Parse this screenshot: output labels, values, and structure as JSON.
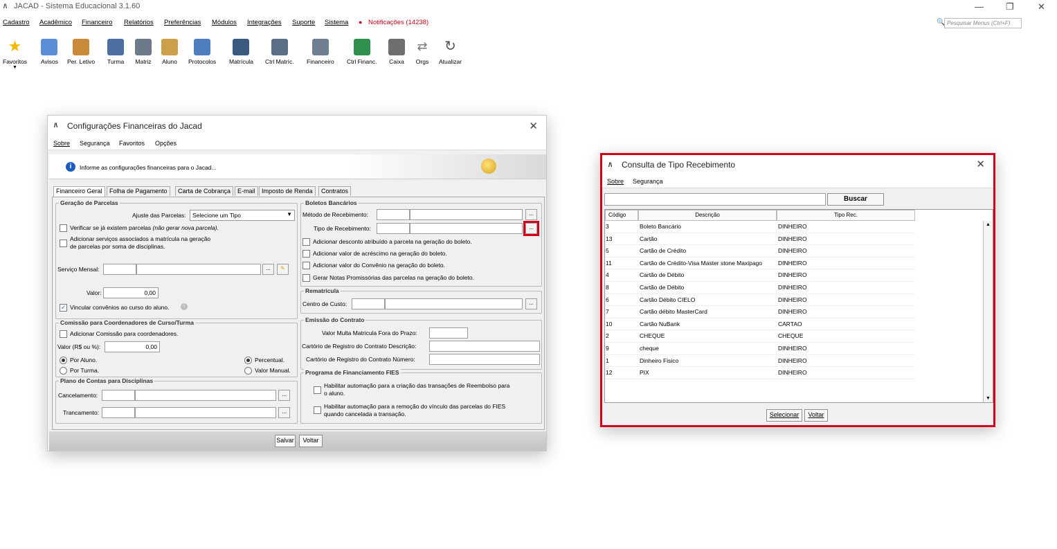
{
  "app": {
    "logo": "/\\",
    "title": "JACAD - Sistema Educacional 3.1.60"
  },
  "menu": [
    "Cadastro",
    "Acadêmico",
    "Financeiro",
    "Relatórios",
    "Preferências",
    "Módulos",
    "Integrações",
    "Suporte",
    "Sistema"
  ],
  "notifications": "Notificações (14238)",
  "search_placeholder": "Pesquisar Menus (Ctrl+F)",
  "toolbar": [
    {
      "label": "Favoritos",
      "icon": "star-icon",
      "color": "#f5b800"
    },
    {
      "label": "Avisos",
      "icon": "envelope-icon",
      "color": "#5b8ed6"
    },
    {
      "label": "Per. Letivo",
      "icon": "calendar-icon",
      "color": "#c98a3a"
    },
    {
      "label": "Turma",
      "icon": "group-icon",
      "color": "#4a6fa0"
    },
    {
      "label": "Matriz",
      "icon": "matrix-icon",
      "color": "#6c7a8a"
    },
    {
      "label": "Aluno",
      "icon": "student-icon",
      "color": "#caa04a"
    },
    {
      "label": "Protocolos",
      "icon": "protocol-icon",
      "color": "#4d7fc0"
    },
    {
      "label": "Matrícula",
      "icon": "edit-icon",
      "color": "#3b5a80"
    },
    {
      "label": "Ctrl Matríc.",
      "icon": "search-doc-icon",
      "color": "#5a6f85"
    },
    {
      "label": "Financeiro",
      "icon": "finance-user-icon",
      "color": "#6f7f8f"
    },
    {
      "label": "Ctrl Financ.",
      "icon": "money-hand-icon",
      "color": "#2f8f4f"
    },
    {
      "label": "Caixa",
      "icon": "cash-register-icon",
      "color": "#6f6f6f"
    },
    {
      "label": "Orgs",
      "icon": "arrows-icon",
      "color": "#777777"
    },
    {
      "label": "Atualizar",
      "icon": "refresh-icon",
      "color": "#555555"
    }
  ],
  "config": {
    "title": "Configurações Financeiras do Jacad",
    "menu": [
      "Sobre",
      "Segurança",
      "Favoritos",
      "Opções"
    ],
    "info": "Informe as configurações financeiras para o Jacad...",
    "tabs": [
      "Financeiro Geral",
      "Folha de Pagamento",
      "Carta de Cobrança",
      "E-mail",
      "Imposto de Renda",
      "Contratos"
    ],
    "geracao": {
      "title": "Geração de Parcelas",
      "ajuste_label": "Ajuste das Parcelas:",
      "ajuste_value": "Selecione um Tipo",
      "verificar": "Verificar se já existem parcelas",
      "verificar_note": "(não gerar nova parcela).",
      "adicionar_line1": "Adicionar serviços associados a matrícula na geração",
      "adicionar_line2": "de parcelas por soma de disciplinas.",
      "servico_label": "Serviço Mensal:",
      "valor_label": "Valor:",
      "valor_value": "0,00",
      "vincular": "Vincular convênios ao curso do aluno."
    },
    "comissao": {
      "title": "Comissão para Coordenadores de Curso/Turma",
      "adicionar": "Adicionar Comissão para coordenadores.",
      "valor_label": "Valor (R$ ou %):",
      "valor_value": "0,00",
      "por_aluno": "Por Aluno.",
      "por_turma": "Por Turma.",
      "percentual": "Percentual.",
      "valor_manual": "Valor Manual."
    },
    "plano": {
      "title": "Plano de Contas para Disciplinas",
      "cancelamento": "Cancelamento:",
      "trancamento": "Trancamento:"
    },
    "boletos": {
      "title": "Boletos Bancários",
      "metodo": "Método de Recebimento:",
      "tipo": "Tipo de Recebimento:",
      "check1": "Adicionar desconto atribuído a parcela na geração do boleto.",
      "check2": "Adicionar valor de acréscimo na geração do boleto.",
      "check3": "Adicionar valor do Convênio na geração do boleto.",
      "check4": "Gerar Notas Promissórias das parcelas na geração do boleto."
    },
    "rematricula": {
      "title": "Rematrícula",
      "centro": "Centro de Custo:"
    },
    "contrato": {
      "title": "Emissão do Contrato",
      "multa": "Valor Multa Matricula Fora do Prazo:",
      "cartorio_desc": "Cartório de Registro do Contrato Descrição:",
      "cartorio_num": "Cartório de Registro do Contrato Número:"
    },
    "fies": {
      "title": "Programa de Financiamento FIES",
      "c1a": "Habilitar automação para a criação das transações de Reembolso para",
      "c1b": "o aluno.",
      "c2a": "Habilitar automação para a remoção do vínculo das parcelas do FIES",
      "c2b": "quando cancelada a transação."
    },
    "salvar": "Salvar",
    "voltar": "Voltar"
  },
  "consulta": {
    "title": "Consulta de Tipo Recebimento",
    "menu": [
      "Sobre",
      "Segurança"
    ],
    "buscar": "Buscar",
    "columns": [
      "Código",
      "Descrição",
      "Tipo Rec."
    ],
    "rows": [
      {
        "codigo": "3",
        "descricao": "Boleto Bancário",
        "tipo": "DINHEIRO"
      },
      {
        "codigo": "13",
        "descricao": "Cartão",
        "tipo": "DINHEIRO"
      },
      {
        "codigo": "5",
        "descricao": "Cartão de Crédito",
        "tipo": "DINHEIRO"
      },
      {
        "codigo": "11",
        "descricao": "Cartão de Crédito-Visa Master stone Maxipago",
        "tipo": "DINHEIRO"
      },
      {
        "codigo": "4",
        "descricao": "Cartão de Débito",
        "tipo": "DINHEIRO"
      },
      {
        "codigo": "8",
        "descricao": "Cartão de Débito",
        "tipo": "DINHEIRO"
      },
      {
        "codigo": "6",
        "descricao": "Cartão Débito CIELO",
        "tipo": "DINHEIRO"
      },
      {
        "codigo": "7",
        "descricao": "Cartão débito MasterCard",
        "tipo": "DINHEIRO"
      },
      {
        "codigo": "10",
        "descricao": "Cartão NuBank",
        "tipo": "CARTAO"
      },
      {
        "codigo": "2",
        "descricao": "CHEQUE",
        "tipo": "CHEQUE"
      },
      {
        "codigo": "9",
        "descricao": "cheque",
        "tipo": "DINHEIRO"
      },
      {
        "codigo": "1",
        "descricao": "Dinheiro Fisico",
        "tipo": "DINHEIRO"
      },
      {
        "codigo": "12",
        "descricao": "PIX",
        "tipo": "DINHEIRO"
      }
    ],
    "selecionar": "Selecionar",
    "voltar": "Voltar"
  },
  "colors": {
    "highlight": "#d0021b",
    "notification": "#d0021b"
  }
}
